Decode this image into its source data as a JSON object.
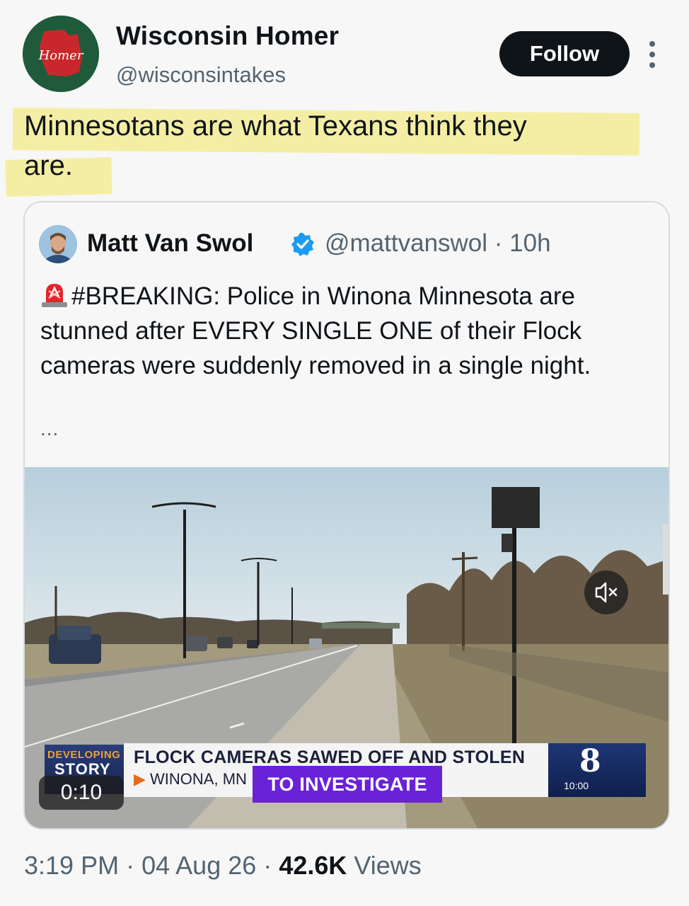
{
  "author": {
    "display_name": "Wisconsin Homer",
    "handle": "@wisconsintakes",
    "avatar_text": "Homer"
  },
  "follow_label": "Follow",
  "tweet_text_line1": "Minnesotans are what Texans think they",
  "tweet_text_line2": "are.",
  "quoted": {
    "display_name": "Matt Van Swol",
    "handle": "@mattvanswol",
    "separator": "·",
    "age": "10h",
    "text": "#BREAKING: Police in Winona Minnesota are stunned after EVERY SINGLE ONE of their Flock cameras were suddenly removed in a single night.",
    "ellipsis": "...",
    "video": {
      "badge_top": "DEVELOPING",
      "badge_bottom": "STORY",
      "headline": "FLOCK CAMERAS SAWED OFF AND STOLEN",
      "subline": "WINONA, MN",
      "callout": "TO INVESTIGATE",
      "channel": "8",
      "clock": "10:00",
      "timer": "0:10"
    }
  },
  "footer": {
    "time": "3:19 PM",
    "dot": "·",
    "date": "04 Aug 26",
    "views_count": "42.6K",
    "views_label": "Views"
  },
  "colors": {
    "follow_bg": "#0f1419",
    "highlight": "#f3ec9a",
    "verified": "#1d9bf0",
    "callout": "#6a22d6"
  },
  "icons": [
    "more-icon",
    "verified-icon",
    "siren-icon",
    "mute-icon"
  ]
}
